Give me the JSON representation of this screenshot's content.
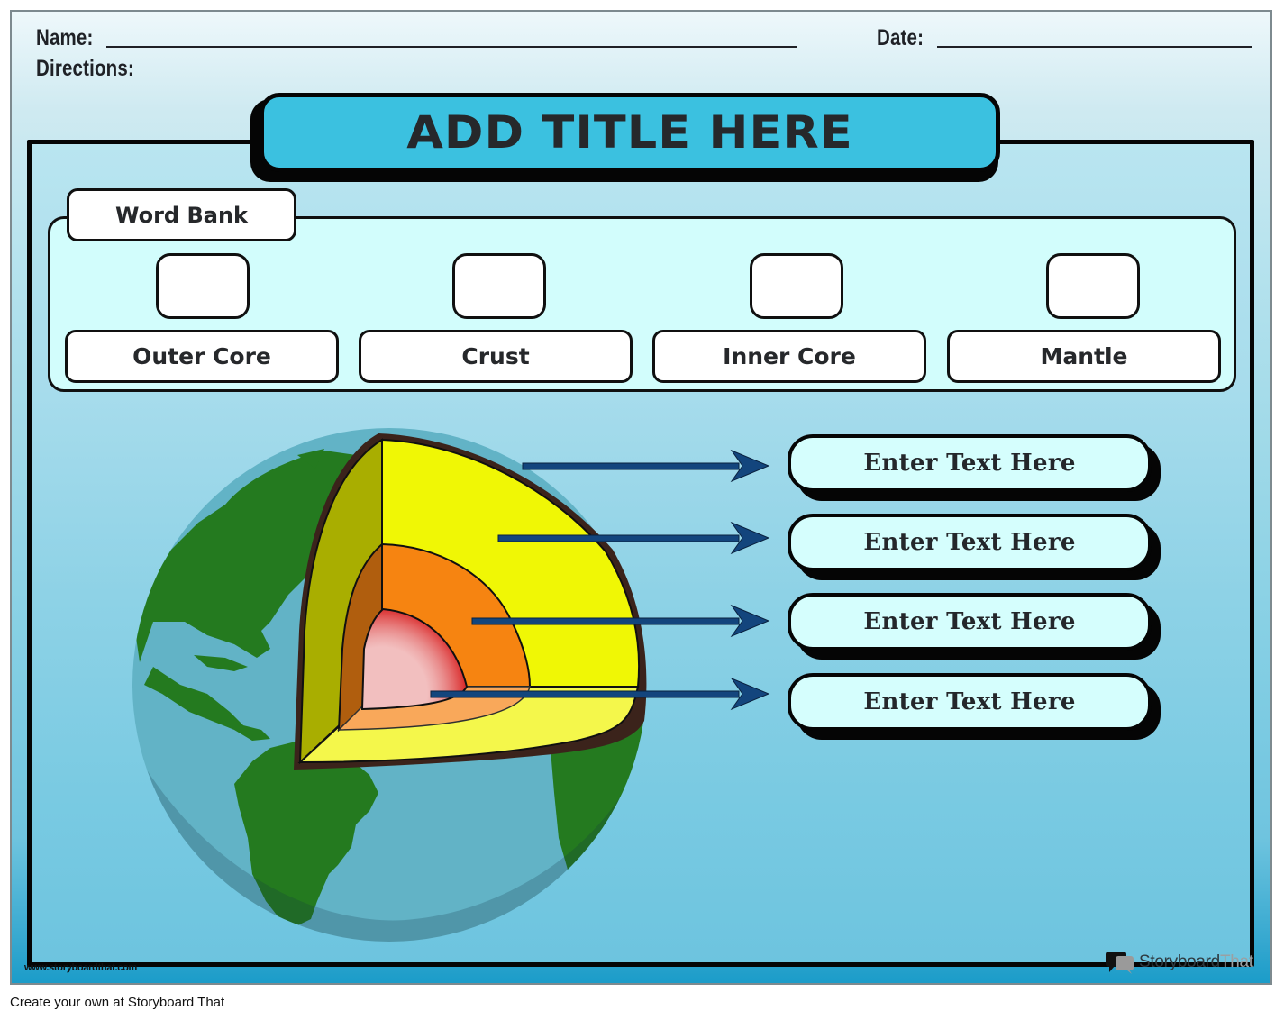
{
  "worksheet": {
    "header": {
      "name_label": "Name:",
      "date_label": "Date:",
      "directions_label": "Directions:"
    },
    "title": "ADD TITLE HERE",
    "word_bank": {
      "label": "Word Bank",
      "words": [
        "Outer Core",
        "Crust",
        "Inner Core",
        "Mantle"
      ]
    },
    "diagram": {
      "subject": "earth-layers-cutaway",
      "label_boxes": [
        "Enter Text Here",
        "Enter Text Here",
        "Enter Text Here",
        "Enter Text Here"
      ],
      "colors": {
        "ocean": "#62b3c6",
        "land": "#247a1f",
        "crust": "#3b231b",
        "mantle": "#f0f705",
        "mantle_side": "#a9ae00",
        "outer_core": "#f68411",
        "outer_core_side": "#b05e0e",
        "inner_core_edge": "#d40000",
        "inner_core_center": "#f2bfbf",
        "arrow": "#13457d"
      }
    },
    "watermark": "www.storyboardthat.com",
    "brand": {
      "name_part1": "Storyboard",
      "name_part2": "That"
    }
  },
  "footer": {
    "text": "Create your own at Storyboard That"
  }
}
